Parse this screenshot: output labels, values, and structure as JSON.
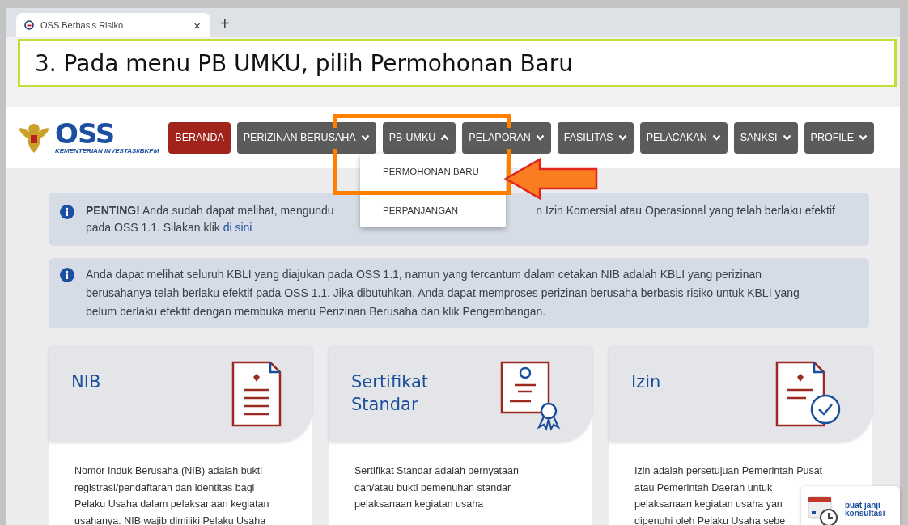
{
  "browser_tab": {
    "title": "OSS Berbasis Risiko",
    "close": "×",
    "new_tab": "+"
  },
  "instruction": "3. Pada menu PB UMKU, pilih Permohonan Baru",
  "logo": {
    "wordmark": "OSS",
    "subtitle": "KEMENTERIAN INVESTASI/BKPM"
  },
  "nav": [
    {
      "label": "BERANDA",
      "kind": "link",
      "selected": true,
      "expanded": false
    },
    {
      "label": "PERIZINAN BERUSAHA",
      "kind": "dropdown",
      "selected": false,
      "expanded": false
    },
    {
      "label": "PB-UMKU",
      "kind": "dropdown",
      "selected": false,
      "expanded": true
    },
    {
      "label": "PELAPORAN",
      "kind": "dropdown",
      "selected": false,
      "expanded": false
    },
    {
      "label": "FASILITAS",
      "kind": "dropdown",
      "selected": false,
      "expanded": false
    },
    {
      "label": "PELACAKAN",
      "kind": "dropdown",
      "selected": false,
      "expanded": false
    },
    {
      "label": "SANKSI",
      "kind": "dropdown",
      "selected": false,
      "expanded": false
    },
    {
      "label": "PROFILE",
      "kind": "dropdown",
      "selected": false,
      "expanded": false
    }
  ],
  "dropdown": [
    {
      "label": "PERMOHONAN BARU"
    },
    {
      "label": "PERPANJANGAN"
    }
  ],
  "alerts": [
    {
      "text_left": "**PENTING!** Anda sudah dapat melihat, mengundu",
      "text_right": "n Izin Komersial atau Operasional yang telah berlaku efektif",
      "text_line2": "pada OSS 1.1. Silakan klik",
      "link": "di sini"
    },
    {
      "text": "Anda dapat melihat seluruh KBLI yang diajukan pada OSS 1.1, namun yang tercantum dalam cetakan NIB adalah KBLI yang perizinan berusahanya telah berlaku efektif pada OSS 1.1. Jika dibutuhkan, Anda dapat memproses perizinan berusaha berbasis risiko untuk KBLI yang belum berlaku efektif dengan membuka menu Perizinan Berusaha dan klik Pengembangan."
    }
  ],
  "cards": [
    {
      "title": "NIB",
      "kind": "document",
      "description": [
        "Nomor Induk Berusaha (NIB) adalah bukti\nregistrasi/pendaftaran dan identitas bagi\nPelaku Usaha dalam pelaksanaan kegiatan\nusahanya. NIB wajib dimiliki Pelaku Usaha"
      ]
    },
    {
      "title": "Sertifikat Standar",
      "kind": "certificate",
      "description": [
        "Sertifikat Standar adalah pernyataan\ndan/atau bukti pemenuhan standar\npelaksanaan kegiatan usaha"
      ]
    },
    {
      "title": "Izin",
      "kind": "approval",
      "description": [
        "Izin adalah persetujuan Pemerintah Pusat\natau Pemerintah Daerah untuk",
        "pelaksanaan kegiatan usaha yan\ndipenuhi oleh Pelaku Usaha sebe"
      ]
    }
  ],
  "consult_widget": {
    "line1": "buat janji",
    "line2": "konsultasi"
  }
}
